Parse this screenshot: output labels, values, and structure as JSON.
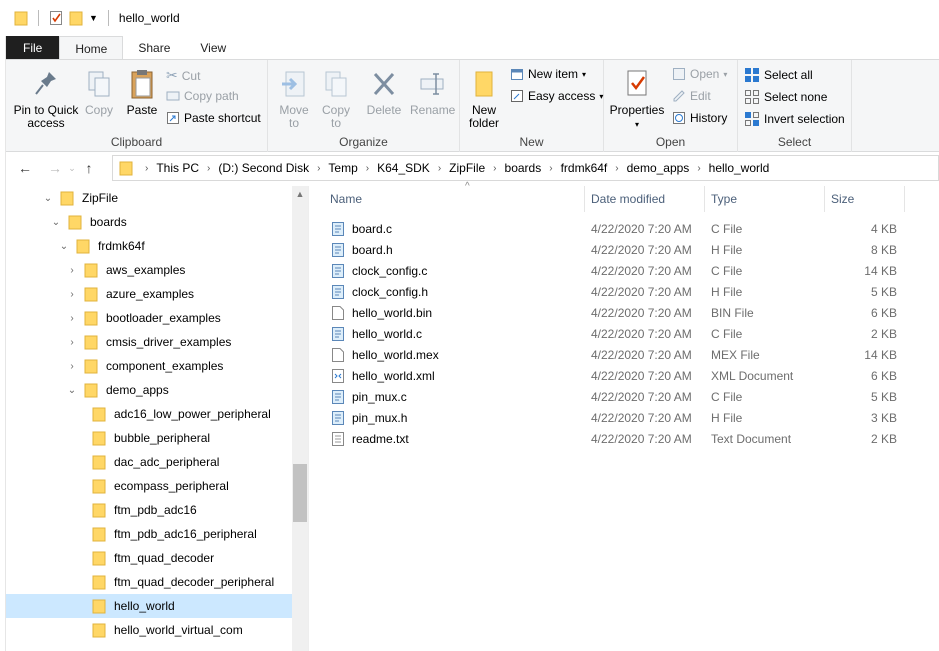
{
  "window": {
    "title": "hello_world"
  },
  "tabs": [
    {
      "label": "File"
    },
    {
      "label": "Home"
    },
    {
      "label": "Share"
    },
    {
      "label": "View"
    }
  ],
  "ribbon": {
    "clipboard": {
      "label": "Clipboard",
      "pin": "Pin to Quick access",
      "copy": "Copy",
      "paste": "Paste",
      "cut": "Cut",
      "copy_path": "Copy path",
      "paste_shortcut": "Paste shortcut"
    },
    "organize": {
      "label": "Organize",
      "move_to": "Move to",
      "copy_to": "Copy to",
      "delete": "Delete",
      "rename": "Rename"
    },
    "new": {
      "label": "New",
      "new_folder": "New folder",
      "new_item": "New item",
      "easy_access": "Easy access"
    },
    "open": {
      "label": "Open",
      "properties": "Properties",
      "open": "Open",
      "edit": "Edit",
      "history": "History"
    },
    "select": {
      "label": "Select",
      "select_all": "Select all",
      "select_none": "Select none",
      "invert": "Invert selection"
    }
  },
  "address": {
    "crumbs": [
      "This PC",
      "(D:) Second Disk",
      "Temp",
      "K64_SDK",
      "ZipFile",
      "boards",
      "frdmk64f",
      "demo_apps",
      "hello_world"
    ]
  },
  "tree": [
    {
      "label": "ZipFile",
      "level": 0,
      "state": "expanded"
    },
    {
      "label": "boards",
      "level": 1,
      "state": "expanded"
    },
    {
      "label": "frdmk64f",
      "level": 2,
      "state": "expanded"
    },
    {
      "label": "aws_examples",
      "level": 3,
      "state": "collapsed"
    },
    {
      "label": "azure_examples",
      "level": 3,
      "state": "collapsed"
    },
    {
      "label": "bootloader_examples",
      "level": 3,
      "state": "collapsed"
    },
    {
      "label": "cmsis_driver_examples",
      "level": 3,
      "state": "collapsed"
    },
    {
      "label": "component_examples",
      "level": 3,
      "state": "collapsed"
    },
    {
      "label": "demo_apps",
      "level": 3,
      "state": "expanded"
    },
    {
      "label": "adc16_low_power_peripheral",
      "level": 4,
      "state": "none"
    },
    {
      "label": "bubble_peripheral",
      "level": 4,
      "state": "none"
    },
    {
      "label": "dac_adc_peripheral",
      "level": 4,
      "state": "none"
    },
    {
      "label": "ecompass_peripheral",
      "level": 4,
      "state": "none"
    },
    {
      "label": "ftm_pdb_adc16",
      "level": 4,
      "state": "none"
    },
    {
      "label": "ftm_pdb_adc16_peripheral",
      "level": 4,
      "state": "none"
    },
    {
      "label": "ftm_quad_decoder",
      "level": 4,
      "state": "none"
    },
    {
      "label": "ftm_quad_decoder_peripheral",
      "level": 4,
      "state": "none"
    },
    {
      "label": "hello_world",
      "level": 4,
      "state": "none",
      "selected": true
    },
    {
      "label": "hello_world_virtual_com",
      "level": 4,
      "state": "none"
    }
  ],
  "columns": {
    "name": "Name",
    "date": "Date modified",
    "type": "Type",
    "size": "Size"
  },
  "files": [
    {
      "name": "board.c",
      "date": "4/22/2020 7:20 AM",
      "type": "C File",
      "size": "4 KB",
      "icon": "source-file-icon"
    },
    {
      "name": "board.h",
      "date": "4/22/2020 7:20 AM",
      "type": "H File",
      "size": "8 KB",
      "icon": "source-file-icon"
    },
    {
      "name": "clock_config.c",
      "date": "4/22/2020 7:20 AM",
      "type": "C File",
      "size": "14 KB",
      "icon": "source-file-icon"
    },
    {
      "name": "clock_config.h",
      "date": "4/22/2020 7:20 AM",
      "type": "H File",
      "size": "5 KB",
      "icon": "source-file-icon"
    },
    {
      "name": "hello_world.bin",
      "date": "4/22/2020 7:20 AM",
      "type": "BIN File",
      "size": "6 KB",
      "icon": "blank-file-icon"
    },
    {
      "name": "hello_world.c",
      "date": "4/22/2020 7:20 AM",
      "type": "C File",
      "size": "2 KB",
      "icon": "source-file-icon"
    },
    {
      "name": "hello_world.mex",
      "date": "4/22/2020 7:20 AM",
      "type": "MEX File",
      "size": "14 KB",
      "icon": "blank-file-icon"
    },
    {
      "name": "hello_world.xml",
      "date": "4/22/2020 7:20 AM",
      "type": "XML Document",
      "size": "6 KB",
      "icon": "xml-file-icon"
    },
    {
      "name": "pin_mux.c",
      "date": "4/22/2020 7:20 AM",
      "type": "C File",
      "size": "5 KB",
      "icon": "source-file-icon"
    },
    {
      "name": "pin_mux.h",
      "date": "4/22/2020 7:20 AM",
      "type": "H File",
      "size": "3 KB",
      "icon": "source-file-icon"
    },
    {
      "name": "readme.txt",
      "date": "4/22/2020 7:20 AM",
      "type": "Text Document",
      "size": "2 KB",
      "icon": "text-file-icon"
    }
  ],
  "colors": {
    "folder": "#ffd766",
    "selection": "#cce8ff",
    "accent": "#2b79d0",
    "header_text": "#4c607a"
  }
}
